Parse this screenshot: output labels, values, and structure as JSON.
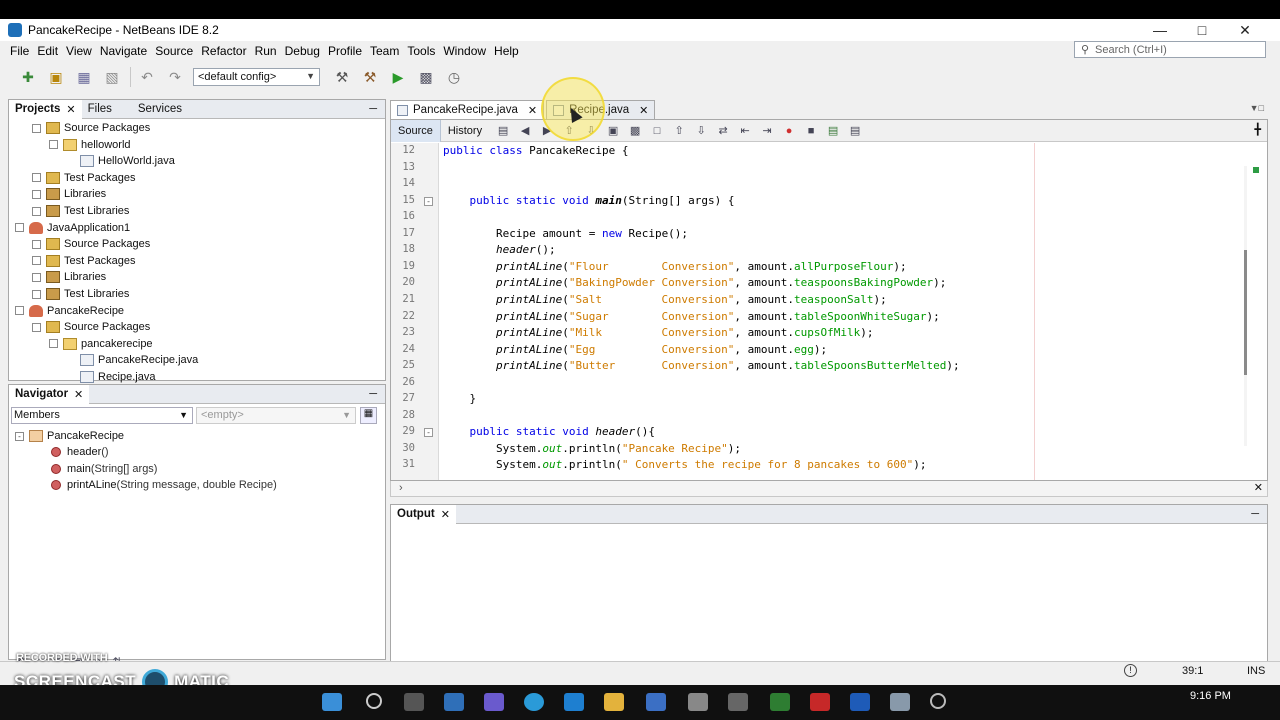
{
  "window": {
    "title": "PancakeRecipe - NetBeans IDE 8.2",
    "controls": [
      "—",
      "□",
      "✕"
    ]
  },
  "menu": [
    "File",
    "Edit",
    "View",
    "Navigate",
    "Source",
    "Refactor",
    "Run",
    "Debug",
    "Profile",
    "Team",
    "Tools",
    "Window",
    "Help"
  ],
  "search": {
    "placeholder": "Search (Ctrl+I)"
  },
  "toolbar": {
    "config": "<default config>"
  },
  "projects_panel": {
    "tabs": [
      "Projects",
      "Files",
      "Services"
    ],
    "tree": [
      {
        "label": "Source Packages",
        "depth": 1,
        "icon": "folder-icon",
        "expander": "-"
      },
      {
        "label": "helloworld",
        "depth": 2,
        "icon": "package-icon",
        "expander": "-"
      },
      {
        "label": "HelloWorld.java",
        "depth": 3,
        "icon": "java-file-icon",
        "expander": ""
      },
      {
        "label": "Test Packages",
        "depth": 1,
        "icon": "folder-icon",
        "expander": "+"
      },
      {
        "label": "Libraries",
        "depth": 1,
        "icon": "library-icon",
        "expander": "+"
      },
      {
        "label": "Test Libraries",
        "depth": 1,
        "icon": "library-icon",
        "expander": "+"
      },
      {
        "label": "JavaApplication1",
        "depth": 0,
        "icon": "project-icon",
        "expander": "-"
      },
      {
        "label": "Source Packages",
        "depth": 1,
        "icon": "folder-icon",
        "expander": "+"
      },
      {
        "label": "Test Packages",
        "depth": 1,
        "icon": "folder-icon",
        "expander": "+"
      },
      {
        "label": "Libraries",
        "depth": 1,
        "icon": "library-icon",
        "expander": "+"
      },
      {
        "label": "Test Libraries",
        "depth": 1,
        "icon": "library-icon",
        "expander": "+"
      },
      {
        "label": "PancakeRecipe",
        "depth": 0,
        "icon": "project-icon",
        "expander": "-"
      },
      {
        "label": "Source Packages",
        "depth": 1,
        "icon": "folder-icon",
        "expander": "-"
      },
      {
        "label": "pancakerecipe",
        "depth": 2,
        "icon": "package-icon",
        "expander": "-"
      },
      {
        "label": "PancakeRecipe.java",
        "depth": 3,
        "icon": "java-file-icon",
        "expander": ""
      },
      {
        "label": "Recipe.java",
        "depth": 3,
        "icon": "java-file-icon",
        "expander": ""
      }
    ]
  },
  "navigator": {
    "title": "Navigator",
    "filter": "Members",
    "scope": "<empty>",
    "class_name": "PancakeRecipe",
    "members": [
      {
        "name": "header",
        "params": "()"
      },
      {
        "name": "main",
        "params": "(String[] args)"
      },
      {
        "name": "printALine",
        "params": "(String message, double Recipe)"
      }
    ]
  },
  "editor": {
    "tabs": [
      {
        "label": "PancakeRecipe.java",
        "active": true
      },
      {
        "label": "Recipe.java",
        "active": false
      }
    ],
    "views": [
      "Source",
      "History"
    ],
    "lines": [
      {
        "n": "12",
        "text": "public class PancakeRecipe {"
      },
      {
        "n": "13",
        "text": ""
      },
      {
        "n": "14",
        "text": ""
      },
      {
        "n": "15",
        "text": "    public static void main(String[] args) {"
      },
      {
        "n": "16",
        "text": ""
      },
      {
        "n": "17",
        "text": "        Recipe amount = new Recipe();"
      },
      {
        "n": "18",
        "text": "        header();"
      },
      {
        "n": "19",
        "text": "        printALine(\"Flour        Conversion\", amount.allPurposeFlour);"
      },
      {
        "n": "20",
        "text": "        printALine(\"BakingPowder Conversion\", amount.teaspoonsBakingPowder);"
      },
      {
        "n": "21",
        "text": "        printALine(\"Salt         Conversion\", amount.teaspoonSalt);"
      },
      {
        "n": "22",
        "text": "        printALine(\"Sugar        Conversion\", amount.tableSpoonWhiteSugar);"
      },
      {
        "n": "23",
        "text": "        printALine(\"Milk         Conversion\", amount.cupsOfMilk);"
      },
      {
        "n": "24",
        "text": "        printALine(\"Egg          Conversion\", amount.egg);"
      },
      {
        "n": "25",
        "text": "        printALine(\"Butter       Conversion\", amount.tableSpoonsButterMelted);"
      },
      {
        "n": "26",
        "text": ""
      },
      {
        "n": "27",
        "text": "    }"
      },
      {
        "n": "28",
        "text": ""
      },
      {
        "n": "29",
        "text": "    public static void header(){"
      },
      {
        "n": "30",
        "text": "        System.out.println(\"Pancake Recipe\");"
      },
      {
        "n": "31",
        "text": "        System.out.println(\" Converts the recipe for 8 pancakes to 600\");"
      }
    ]
  },
  "output": {
    "title": "Output"
  },
  "status": {
    "position": "39:1",
    "mode": "INS"
  },
  "watermark": {
    "line1": "RECORDED WITH",
    "line2a": "SCREENCAST",
    "line2b": "MATIC"
  },
  "taskbar": {
    "time": "9:16 PM"
  },
  "colors": {
    "keyword": "#0000e6",
    "string": "#ce7b00",
    "field": "#009900"
  }
}
